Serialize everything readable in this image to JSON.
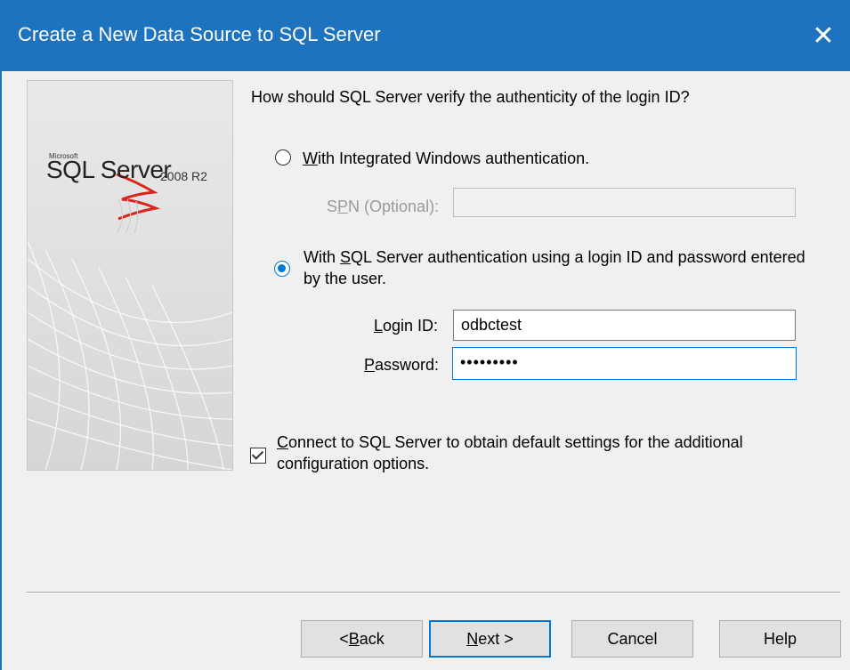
{
  "window": {
    "title": "Create a New Data Source to SQL Server",
    "close_glyph": "✕"
  },
  "banner": {
    "microsoft": "Microsoft",
    "product": "SQL Server",
    "version": "2008 R2"
  },
  "question": "How should SQL Server verify the authenticity of the login ID?",
  "auth_integrated": {
    "label_accel": "W",
    "label_rest": "ith Integrated Windows authentication.",
    "checked": false
  },
  "spn": {
    "label_pre": "S",
    "label_accel": "P",
    "label_post": "N (Optional):",
    "value": ""
  },
  "auth_sql": {
    "label_pre": "With ",
    "label_accel": "S",
    "label_post": "QL Server authentication using a login ID and password entered by the user.",
    "checked": true
  },
  "login": {
    "label_accel": "L",
    "label_post": "ogin ID:",
    "value": "odbctest"
  },
  "password": {
    "label_accel": "P",
    "label_post": "assword:",
    "value": "•••••••••"
  },
  "connect": {
    "label_accel": "C",
    "label_post": "onnect to SQL Server to obtain default settings for the additional configuration options.",
    "checked": true
  },
  "buttons": {
    "back": {
      "pre": "< ",
      "accel": "B",
      "post": "ack"
    },
    "next": {
      "pre": "",
      "accel": "N",
      "post": "ext >"
    },
    "cancel": "Cancel",
    "help": "Help"
  },
  "colors": {
    "titlebar": "#1e73be",
    "accent": "#0078d7",
    "logo_red": "#d9261c"
  }
}
